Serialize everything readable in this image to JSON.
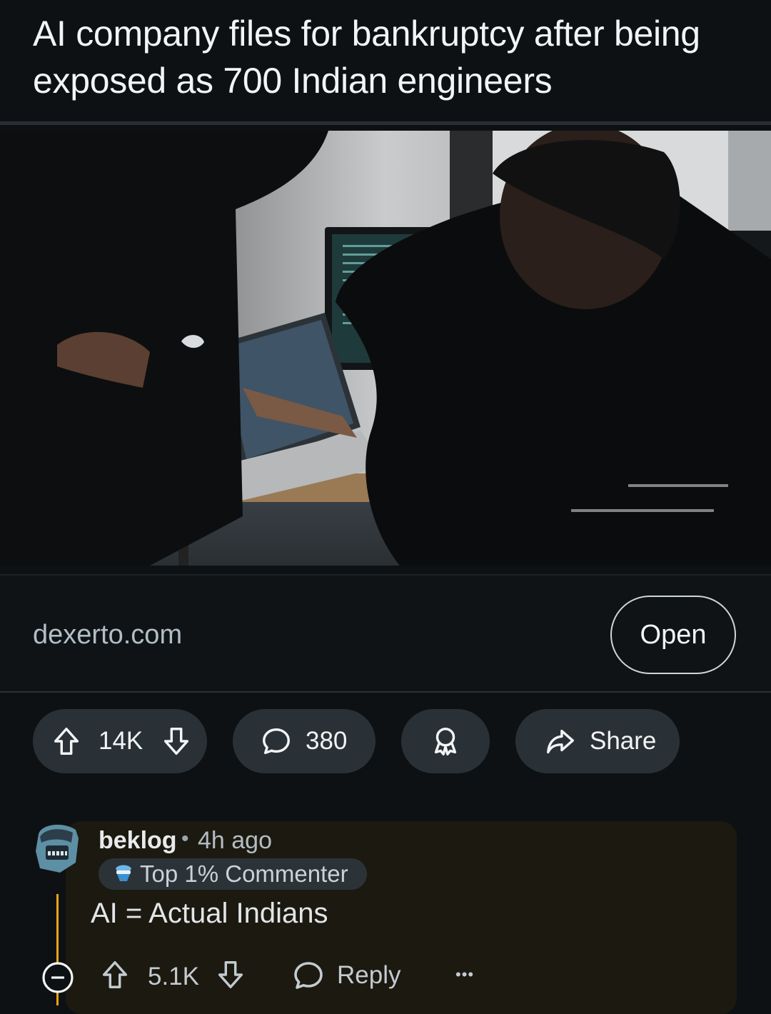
{
  "post": {
    "title": "AI company files for bankruptcy after being exposed as 700 Indian engineers",
    "link_domain": "dexerto.com",
    "open_label": "Open",
    "image_alt": "Two men in an office looking at a laptop with code on screen"
  },
  "actions": {
    "upvotes": "14K",
    "comments": "380",
    "share_label": "Share"
  },
  "comment": {
    "username": "beklog",
    "separator": "•",
    "time": "4h ago",
    "flair": "Top 1% Commenter",
    "body": "AI = Actual Indians",
    "upvotes": "5.1K",
    "reply_label": "Reply",
    "more_label": "•••"
  },
  "icons": {
    "upvote": "arrow-up-icon",
    "downvote": "arrow-down-icon",
    "comment": "speech-bubble-icon",
    "award": "award-ribbon-icon",
    "share": "share-arrow-icon",
    "collapse": "minus-circle-icon",
    "more": "ellipsis-icon"
  },
  "colors": {
    "background": "#0e1113",
    "pill": "#2a3136",
    "thread_highlight": "#e8a317",
    "comment_bg": "#1c1910"
  }
}
